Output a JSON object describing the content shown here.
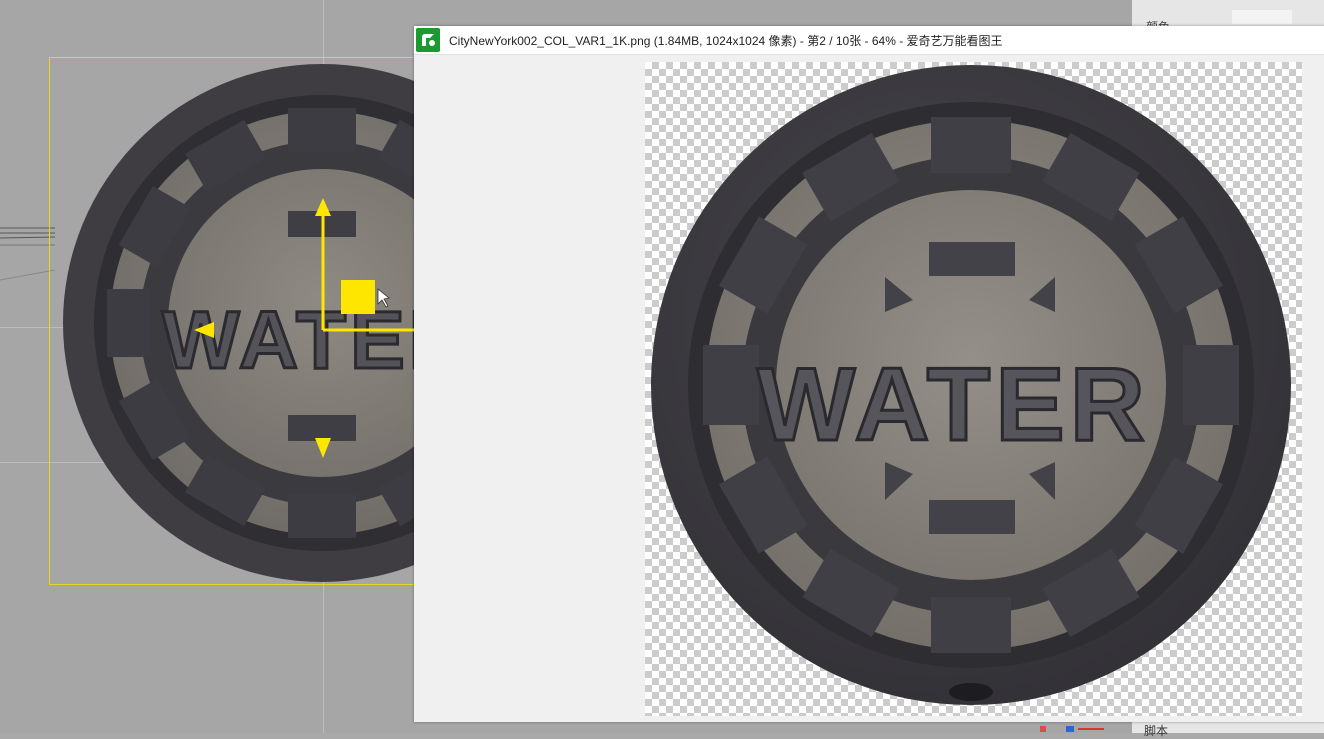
{
  "viewer": {
    "title": "CityNewYork002_COL_VAR1_1K.png (1.84MB, 1024x1024 像素) - 第2 / 10张 - 64% - 爱奇艺万能看图王",
    "icon": "picture-viewer-app-icon",
    "image_embossed_text": "WATER"
  },
  "viewport": {
    "embossed_text": "WATER",
    "gizmo_icon": "move-gizmo-icon",
    "cursor_icon": "mouse-pointer-icon"
  },
  "side_panel": {
    "top_label": "颜色",
    "bottom_label": "脚本"
  },
  "colors": {
    "gizmo": "#ffe600",
    "selection": "#e8d61a",
    "viewer_icon": "#1b9a31",
    "checker": "#cccccc"
  }
}
